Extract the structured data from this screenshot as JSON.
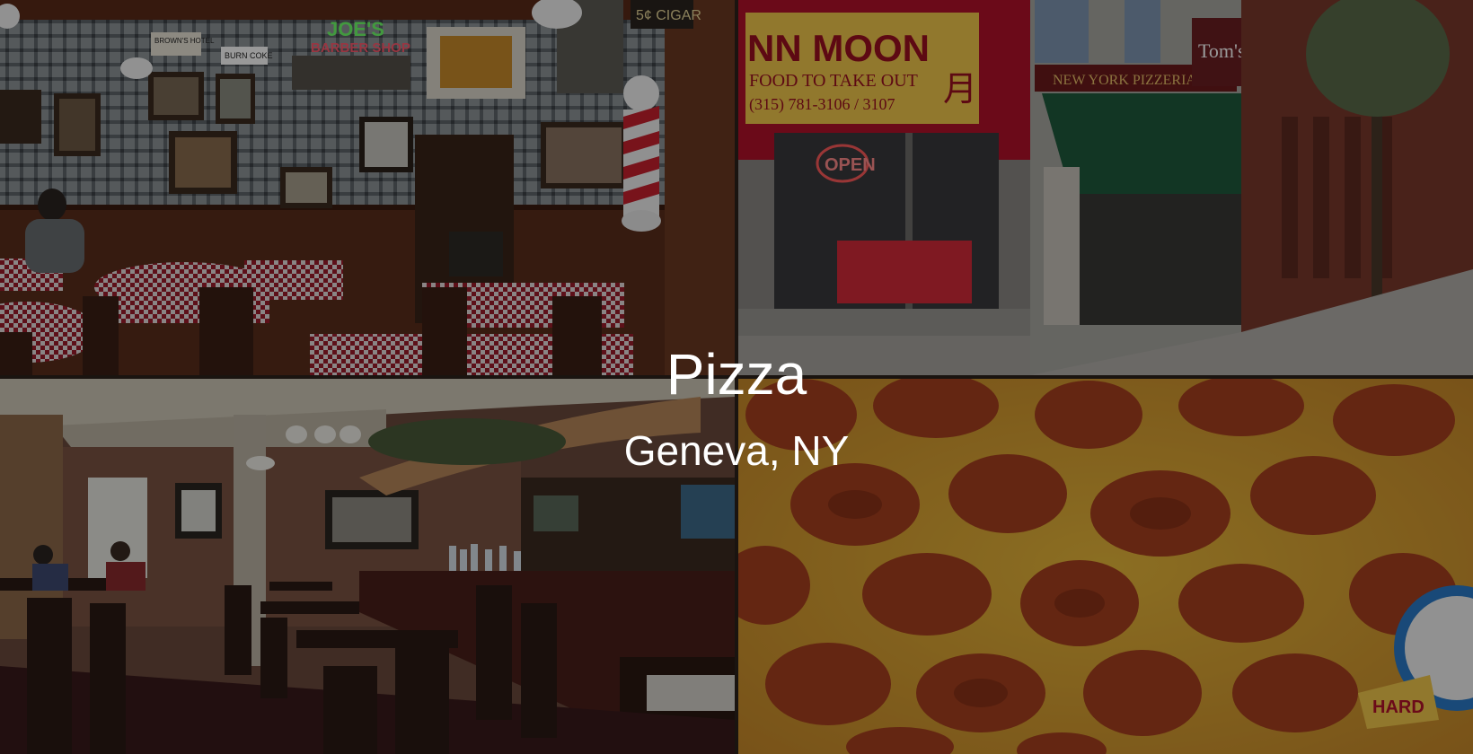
{
  "heading": {
    "title": "Pizza",
    "location": "Geneva, NY"
  },
  "photos": {
    "dining_room": {
      "neon_sign_line1": "JOE'S",
      "neon_sign_line2": "BARBER SHOP",
      "wall_sign_1": "BROWN'S HOTEL",
      "wall_sign_2": "BURN COKE",
      "wall_sign_3": "5¢ CIGAR"
    },
    "storefront": {
      "awning_text": "NN MOON",
      "awning_subtext": "FOOD TO TAKE OUT",
      "phone_text": "(315) 781-3106 / 3107",
      "open_sign": "OPEN",
      "hanging_sign": "Tom's",
      "pizzeria_banner": "NEW YORK PIZZERIA"
    },
    "bar_room": {},
    "pizza": {
      "badge_text": "HARD"
    }
  },
  "colors": {
    "overlay": "rgba(0,0,0,0.40)",
    "text": "#ffffff",
    "awning_red": "#b3122a",
    "awning_green": "#1f5a3c",
    "tablecloth": "#9b1c2b"
  }
}
